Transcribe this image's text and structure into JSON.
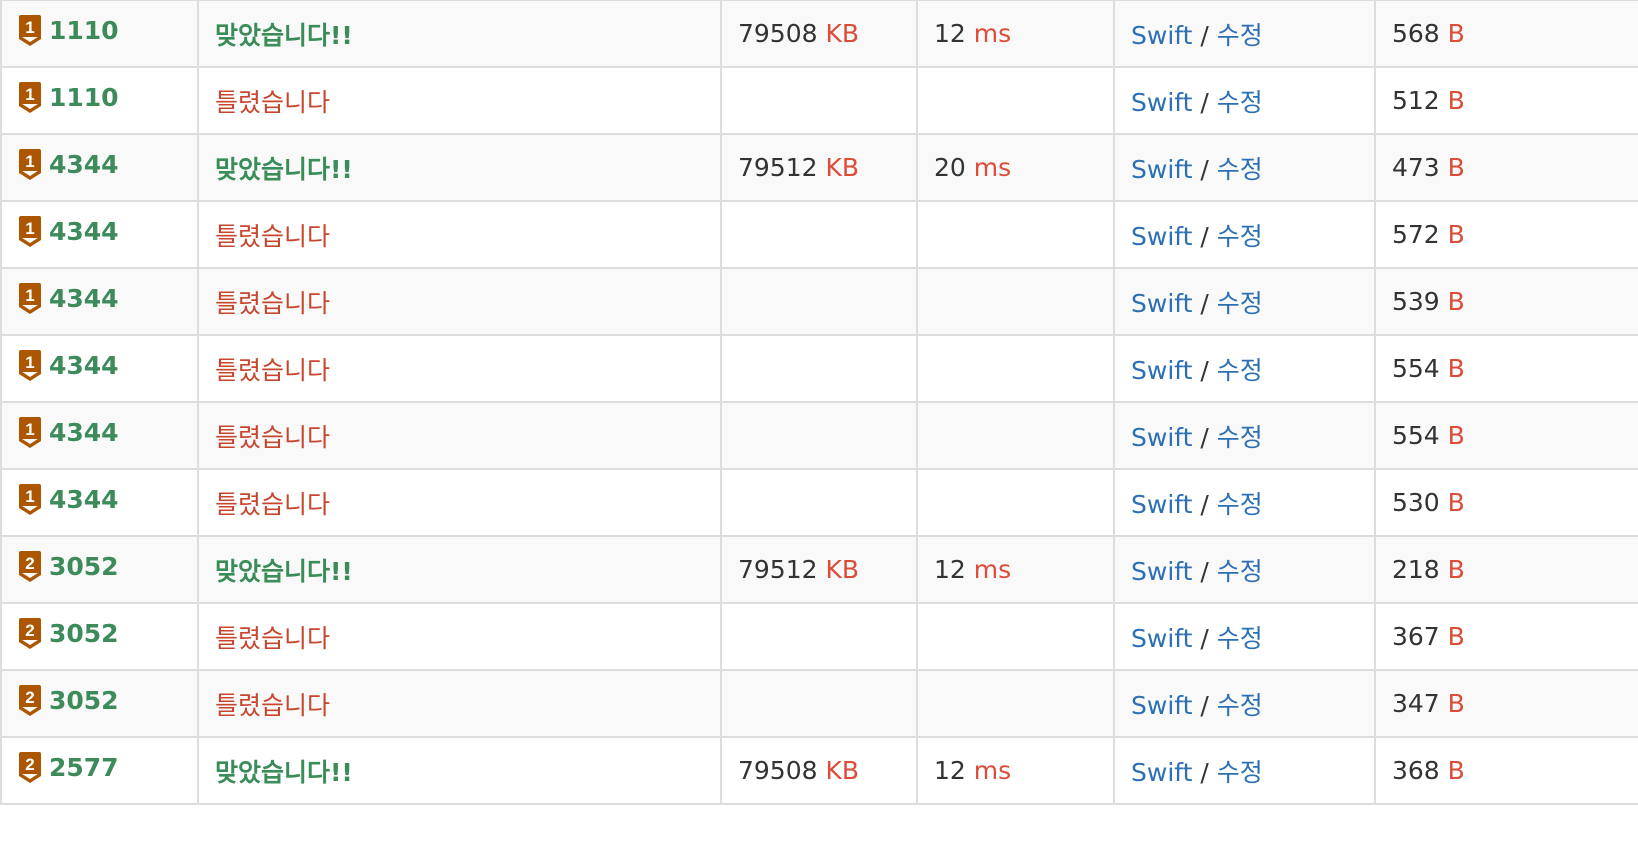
{
  "colors": {
    "accepted": "#3a8c58",
    "wrong": "#c8462e",
    "problem_link": "#3d8b5a",
    "unit": "#dd4b39",
    "link": "#2c6fb5",
    "badge_bronze": "#ad5600"
  },
  "rows": [
    {
      "tier_icon": "bronze-1-tier-icon",
      "tier": "1",
      "problem": "1110",
      "result": "맞았습니다!!",
      "result_type": "ac",
      "memory": "79508",
      "memory_unit": "KB",
      "time": "12",
      "time_unit": "ms",
      "language": "Swift",
      "separator": "/",
      "edit": "수정",
      "length": "568",
      "length_unit": "B"
    },
    {
      "tier_icon": "bronze-1-tier-icon",
      "tier": "1",
      "problem": "1110",
      "result": "틀렸습니다",
      "result_type": "wa",
      "memory": "",
      "memory_unit": "",
      "time": "",
      "time_unit": "",
      "language": "Swift",
      "separator": "/",
      "edit": "수정",
      "length": "512",
      "length_unit": "B"
    },
    {
      "tier_icon": "bronze-1-tier-icon",
      "tier": "1",
      "problem": "4344",
      "result": "맞았습니다!!",
      "result_type": "ac",
      "memory": "79512",
      "memory_unit": "KB",
      "time": "20",
      "time_unit": "ms",
      "language": "Swift",
      "separator": "/",
      "edit": "수정",
      "length": "473",
      "length_unit": "B"
    },
    {
      "tier_icon": "bronze-1-tier-icon",
      "tier": "1",
      "problem": "4344",
      "result": "틀렸습니다",
      "result_type": "wa",
      "memory": "",
      "memory_unit": "",
      "time": "",
      "time_unit": "",
      "language": "Swift",
      "separator": "/",
      "edit": "수정",
      "length": "572",
      "length_unit": "B"
    },
    {
      "tier_icon": "bronze-1-tier-icon",
      "tier": "1",
      "problem": "4344",
      "result": "틀렸습니다",
      "result_type": "wa",
      "memory": "",
      "memory_unit": "",
      "time": "",
      "time_unit": "",
      "language": "Swift",
      "separator": "/",
      "edit": "수정",
      "length": "539",
      "length_unit": "B"
    },
    {
      "tier_icon": "bronze-1-tier-icon",
      "tier": "1",
      "problem": "4344",
      "result": "틀렸습니다",
      "result_type": "wa",
      "memory": "",
      "memory_unit": "",
      "time": "",
      "time_unit": "",
      "language": "Swift",
      "separator": "/",
      "edit": "수정",
      "length": "554",
      "length_unit": "B"
    },
    {
      "tier_icon": "bronze-1-tier-icon",
      "tier": "1",
      "problem": "4344",
      "result": "틀렸습니다",
      "result_type": "wa",
      "memory": "",
      "memory_unit": "",
      "time": "",
      "time_unit": "",
      "language": "Swift",
      "separator": "/",
      "edit": "수정",
      "length": "554",
      "length_unit": "B"
    },
    {
      "tier_icon": "bronze-1-tier-icon",
      "tier": "1",
      "problem": "4344",
      "result": "틀렸습니다",
      "result_type": "wa",
      "memory": "",
      "memory_unit": "",
      "time": "",
      "time_unit": "",
      "language": "Swift",
      "separator": "/",
      "edit": "수정",
      "length": "530",
      "length_unit": "B"
    },
    {
      "tier_icon": "bronze-2-tier-icon",
      "tier": "2",
      "problem": "3052",
      "result": "맞았습니다!!",
      "result_type": "ac",
      "memory": "79512",
      "memory_unit": "KB",
      "time": "12",
      "time_unit": "ms",
      "language": "Swift",
      "separator": "/",
      "edit": "수정",
      "length": "218",
      "length_unit": "B"
    },
    {
      "tier_icon": "bronze-2-tier-icon",
      "tier": "2",
      "problem": "3052",
      "result": "틀렸습니다",
      "result_type": "wa",
      "memory": "",
      "memory_unit": "",
      "time": "",
      "time_unit": "",
      "language": "Swift",
      "separator": "/",
      "edit": "수정",
      "length": "367",
      "length_unit": "B"
    },
    {
      "tier_icon": "bronze-2-tier-icon",
      "tier": "2",
      "problem": "3052",
      "result": "틀렸습니다",
      "result_type": "wa",
      "memory": "",
      "memory_unit": "",
      "time": "",
      "time_unit": "",
      "language": "Swift",
      "separator": "/",
      "edit": "수정",
      "length": "347",
      "length_unit": "B"
    },
    {
      "tier_icon": "bronze-2-tier-icon",
      "tier": "2",
      "problem": "2577",
      "result": "맞았습니다!!",
      "result_type": "ac",
      "memory": "79508",
      "memory_unit": "KB",
      "time": "12",
      "time_unit": "ms",
      "language": "Swift",
      "separator": "/",
      "edit": "수정",
      "length": "368",
      "length_unit": "B"
    }
  ]
}
